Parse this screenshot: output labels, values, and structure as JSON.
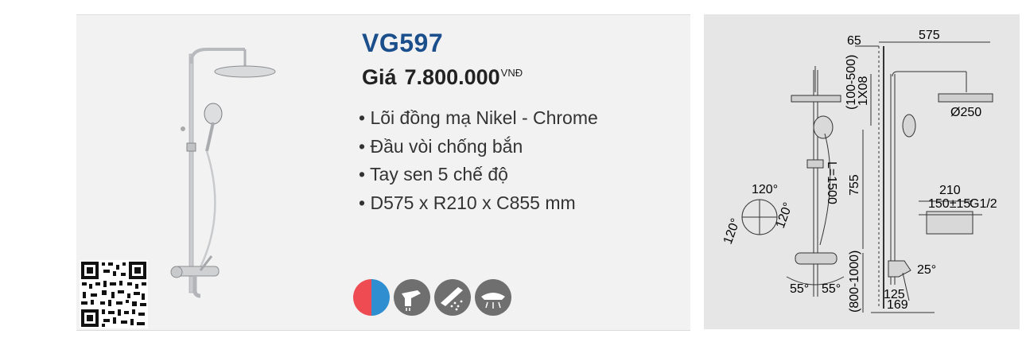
{
  "product": {
    "model": "VG597",
    "price_label": "Giá",
    "price_value": "7.800.000",
    "currency": "VNĐ",
    "features": [
      "Lõi đồng mạ Nikel - Chrome",
      "Đầu vòi chống bắn",
      "Tay sen 5 chế độ",
      "D575 x R210 x C855 mm"
    ]
  },
  "feature_icons": [
    "hot-cold-icon",
    "spout-icon",
    "spray-modes-icon",
    "shower-head-icon"
  ],
  "drawing": {
    "dim_65": "65",
    "dim_575": "575",
    "dim_100_500": "(100-500)",
    "dim_80": "1X08",
    "dim_d250": "Ø250",
    "dim_L1500": "L=1500",
    "dim_755": "755",
    "dim_120_a": "120°",
    "dim_120_b": "120°",
    "dim_120_c": "120°",
    "dim_210": "210",
    "dim_150": "150±15",
    "dim_g12": "G1/2",
    "dim_25": "25°",
    "dim_800_1000": "(800-1000)",
    "dim_55a": "55°",
    "dim_55b": "55°",
    "dim_125": "125",
    "dim_169": "169"
  },
  "colors": {
    "brand_blue": "#1b4f8c",
    "hot": "#ee4b52",
    "cold": "#2f8ed0",
    "icon_grey": "#6f6f6f"
  }
}
